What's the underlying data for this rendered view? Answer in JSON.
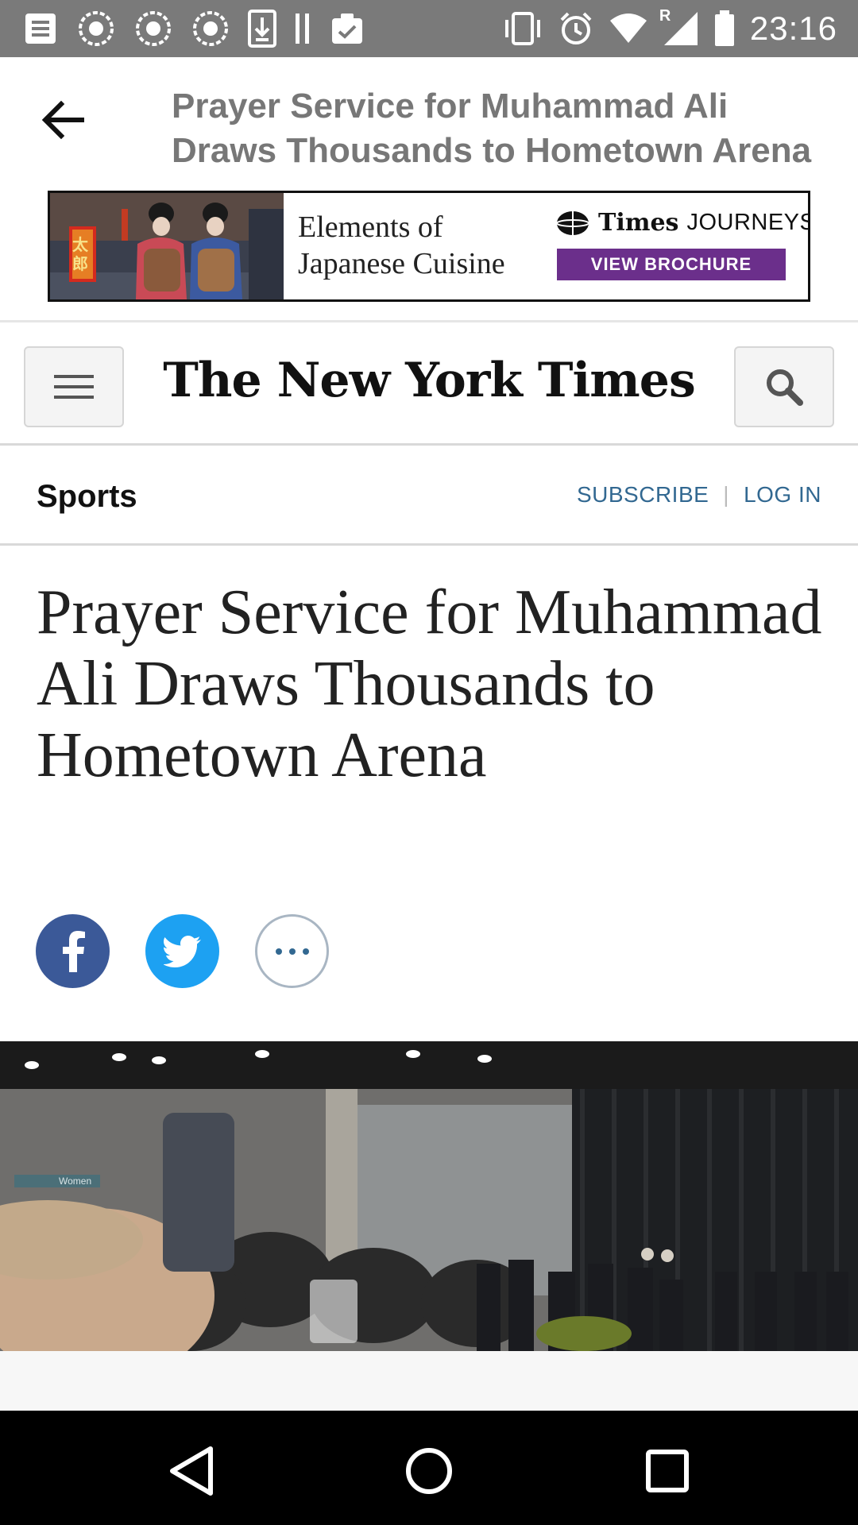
{
  "status_bar": {
    "time": "23:16",
    "left_icons": [
      "document-icon",
      "notification-icon",
      "notification-icon",
      "notification-icon",
      "download-icon",
      "pause-icon",
      "clipboard-check-icon"
    ],
    "right_icons": [
      "vibrate-icon",
      "alarm-icon",
      "wifi-icon",
      "signal-roaming-icon",
      "battery-icon"
    ],
    "roaming_indicator": "R"
  },
  "app_bar": {
    "back_icon": "arrow-back-icon",
    "title": "Prayer Service for Muhammad Ali Draws Thousands to Hometown Arena"
  },
  "ad": {
    "headline_line1": "Elements of",
    "headline_line2": "Japanese Cuisine",
    "brand_times": "Times",
    "brand_journeys": "JOURNEYS",
    "cta": "VIEW BROCHURE",
    "photo_sign": "太郎"
  },
  "masthead": {
    "logo_text": "The New York Times",
    "menu_icon": "hamburger-menu-icon",
    "search_icon": "search-icon"
  },
  "section_bar": {
    "section": "Sports",
    "subscribe": "SUBSCRIBE",
    "separator": "|",
    "login": "LOG IN"
  },
  "article": {
    "headline": "Prayer Service for Muhammad Ali Draws Thousands to Hometown Arena",
    "share": {
      "facebook_icon": "facebook-icon",
      "twitter_icon": "twitter-icon",
      "more_icon": "more-horizontal-icon"
    },
    "hero_sign_text": "Women"
  },
  "nav_bar": {
    "back": "nav-back-icon",
    "home": "nav-home-icon",
    "recents": "nav-recents-icon"
  },
  "colors": {
    "status_bar": "#7a7a7a",
    "link_blue": "#326891",
    "ad_purple": "#6b2f8b",
    "facebook": "#3b5998",
    "twitter": "#1da1f2"
  }
}
